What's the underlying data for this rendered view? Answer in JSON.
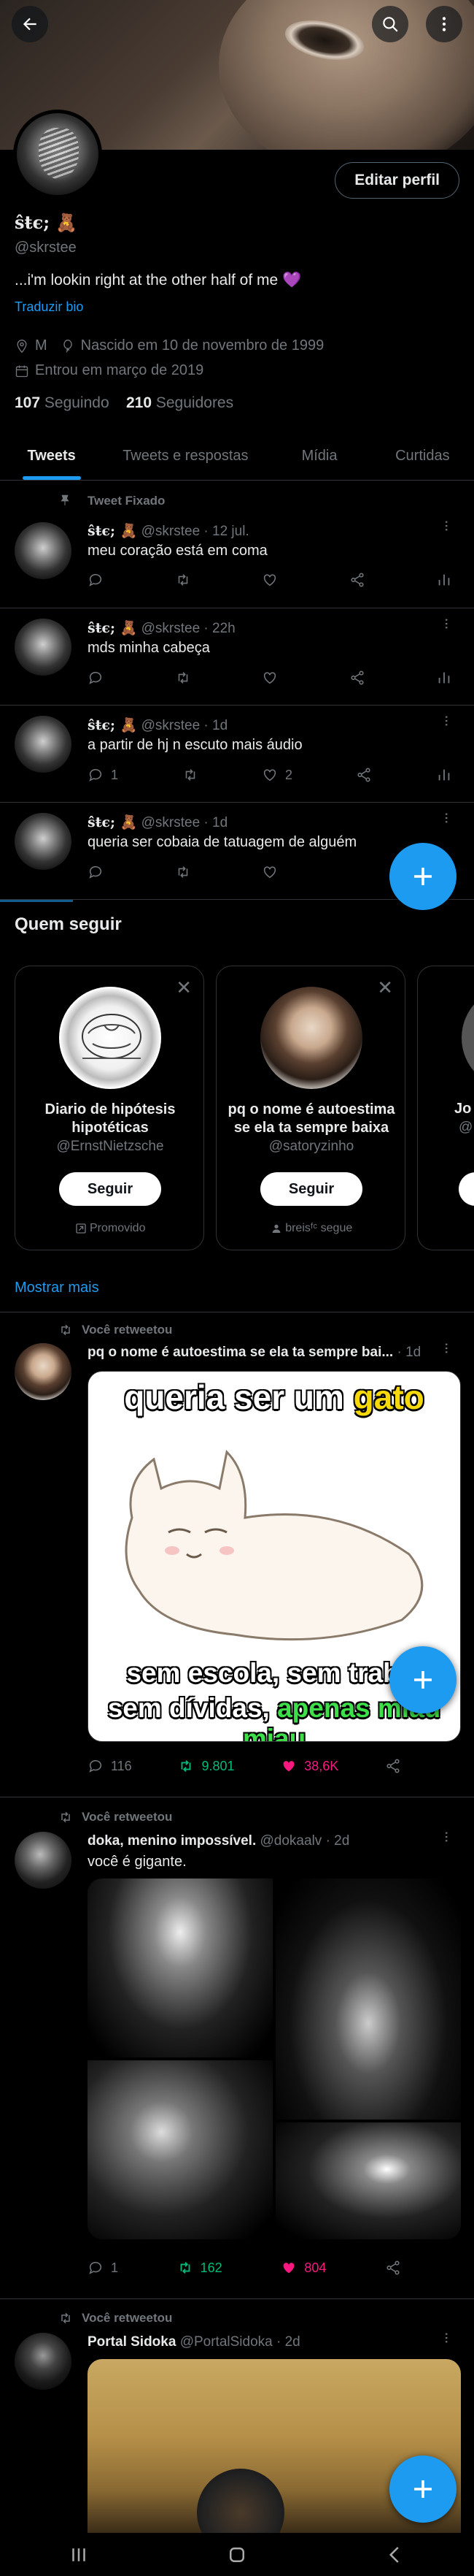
{
  "profile": {
    "name": "ŝŧє; 🧸",
    "handle": "@skrstee",
    "bio": "...i'm lookin right at the other half of me 💜",
    "translate": "Traduzir bio",
    "location": "M",
    "birthday": "Nascido em 10 de novembro de 1999",
    "joined": "Entrou em março de 2019",
    "following_count": "107",
    "following_label": "Seguindo",
    "followers_count": "210",
    "followers_label": "Seguidores",
    "edit_label": "Editar perfil"
  },
  "tabs": [
    "Tweets",
    "Tweets e respostas",
    "Mídia",
    "Curtidas"
  ],
  "pinned_label": "Tweet Fixado",
  "own_tweets": [
    {
      "name": "ŝŧє; 🧸",
      "meta": "@skrstee · 12 jul.",
      "text": "meu coração está em coma",
      "replies": "",
      "likes": ""
    },
    {
      "name": "ŝŧє; 🧸",
      "meta": "@skrstee · 22h",
      "text": "mds minha cabeça",
      "replies": "",
      "likes": ""
    },
    {
      "name": "ŝŧє; 🧸",
      "meta": "@skrstee · 1d",
      "text": "a partir de hj n escuto mais áudio",
      "replies": "1",
      "likes": "2"
    },
    {
      "name": "ŝŧє; 🧸",
      "meta": "@skrstee · 1d",
      "text": "queria ser cobaia de tatuagem de alguém",
      "replies": "",
      "likes": ""
    }
  ],
  "who_to_follow": {
    "title": "Quem seguir",
    "cards": [
      {
        "name": "Diario de hipótesis hipotéticas",
        "handle": "@ErnstNietzsche",
        "button": "Seguir",
        "footer": "Promovido"
      },
      {
        "name": "pq o nome é autoestima se ela ta sempre baixa",
        "handle": "@satoryzinho",
        "button": "Seguir",
        "footer": "breisᶠᶜ segue"
      },
      {
        "name": "Jo",
        "handle": "@",
        "button": "Seguir",
        "footer": ""
      }
    ],
    "show_more": "Mostrar mais"
  },
  "retweets": [
    {
      "rt_label": "Você retweetou",
      "name": "pq o nome é autoestima se ela ta sempre bai...",
      "meta": "· 1d",
      "image": {
        "top_text_a": "queria ser um ",
        "top_text_b": "gato",
        "bottom_line1": "sem escola, sem trabal",
        "bottom_line2a": "sem dívidas, ",
        "bottom_line2b": "apenas miau miau"
      },
      "replies": "116",
      "retweets": "9.801",
      "likes": "38,6K"
    },
    {
      "rt_label": "Você retweetou",
      "name": "doka, menino impossível.",
      "meta": "@dokaalv · 2d",
      "text": "você é gigante.",
      "replies": "1",
      "retweets": "162",
      "likes": "804"
    },
    {
      "rt_label": "Você retweetou",
      "name": "Portal Sidoka",
      "meta": "@PortalSidoka · 2d"
    }
  ],
  "colors": {
    "accent": "#1d9bf0",
    "retweet_green": "#00ba7c",
    "like_pink": "#f91880",
    "muted": "#71767b",
    "border": "#2f3336"
  }
}
